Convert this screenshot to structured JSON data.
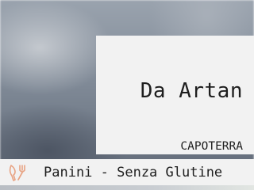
{
  "restaurant": {
    "name": "Da Artan",
    "city": "CAPOTERRA"
  },
  "cuisine": {
    "icon": "cutlery-icon",
    "label": "Panini - Senza Glutine"
  },
  "colors": {
    "card_background": "#f2f2f2",
    "text": "#1e1e1e",
    "icon_accent": "#e8a383"
  }
}
